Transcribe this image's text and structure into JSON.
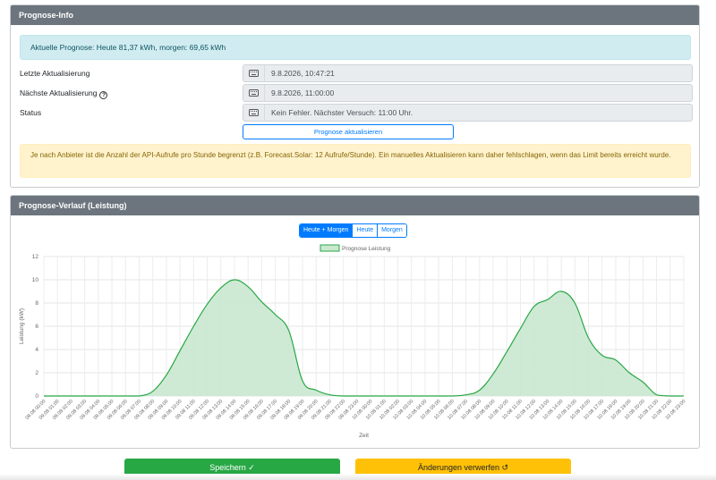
{
  "info_card": {
    "title": "Prognose-Info",
    "forecast_alert": "Aktuelle Prognose: Heute 81,37 kWh, morgen: 69,65 kWh",
    "rows": [
      {
        "label": "Letzte Aktualisierung",
        "value": "9.8.2026, 10:47:21"
      },
      {
        "label": "Nächste Aktualisierung",
        "value": "9.8.2026, 11:00:00"
      },
      {
        "label": "Status",
        "value": "Kein Fehler. Nächster Versuch: 11:00 Uhr."
      }
    ],
    "help_glyph": "?",
    "refresh_button": "Prognose aktualisieren",
    "warning": "Je nach Anbieter ist die Anzahl der API-Aufrufe pro Stunde begrenzt (z.B. Forecast.Solar: 12 Aufrufe/Stunde). Ein manuelles Aktualisieren kann daher fehlschlagen, wenn das Limit bereits erreicht wurde."
  },
  "chart_card": {
    "title": "Prognose-Verlauf (Leistung)",
    "range_buttons": [
      "Heute + Morgen",
      "Heute",
      "Morgen"
    ],
    "active_range": "Heute + Morgen"
  },
  "chart_data": {
    "type": "area",
    "xlabel": "Zeit",
    "ylabel": "Leistung (kW)",
    "ylim": [
      0,
      12
    ],
    "yticks": [
      0,
      2,
      4,
      6,
      8,
      10,
      12
    ],
    "grid": true,
    "legend_position": "top",
    "colors": {
      "line": "#28a745",
      "fill": "#c9e8cf"
    },
    "x": [
      "09.08 00:00",
      "09.08 01:00",
      "09.08 02:00",
      "09.08 03:00",
      "09.08 04:00",
      "09.08 05:00",
      "09.08 06:00",
      "09.08 07:00",
      "09.08 08:00",
      "09.08 09:00",
      "09.08 10:00",
      "09.08 11:00",
      "09.08 12:00",
      "09.08 13:00",
      "09.08 14:00",
      "09.08 15:00",
      "09.08 16:00",
      "09.08 17:00",
      "09.08 18:00",
      "09.08 19:00",
      "09.08 20:00",
      "09.08 21:00",
      "09.08 22:00",
      "09.08 23:00",
      "10.08 00:00",
      "10.08 01:00",
      "10.08 02:00",
      "10.08 03:00",
      "10.08 04:00",
      "10.08 05:00",
      "10.08 06:00",
      "10.08 07:00",
      "10.08 08:00",
      "10.08 09:00",
      "10.08 10:00",
      "10.08 11:00",
      "10.08 12:00",
      "10.08 13:00",
      "10.08 14:00",
      "10.08 15:00",
      "10.08 16:00",
      "10.08 17:00",
      "10.08 18:00",
      "10.08 19:00",
      "10.08 20:00",
      "10.08 21:00",
      "10.08 22:00",
      "10.08 23:00"
    ],
    "series": [
      {
        "name": "Prognose Leistung",
        "values": [
          0,
          0,
          0,
          0,
          0,
          0,
          0,
          0,
          0.4,
          1.8,
          3.9,
          6.0,
          7.9,
          9.3,
          10.0,
          9.4,
          8.1,
          7.0,
          5.6,
          1.3,
          0.5,
          0.1,
          0,
          0,
          0,
          0,
          0,
          0,
          0,
          0,
          0,
          0.1,
          0.5,
          1.9,
          3.8,
          5.8,
          7.7,
          8.3,
          9.0,
          8.0,
          5.0,
          3.5,
          3.1,
          2.0,
          1.2,
          0.1,
          0,
          0
        ]
      }
    ]
  },
  "footer": {
    "save_label": "Speichern ✓",
    "discard_label": "Änderungen verwerfen ↺"
  }
}
